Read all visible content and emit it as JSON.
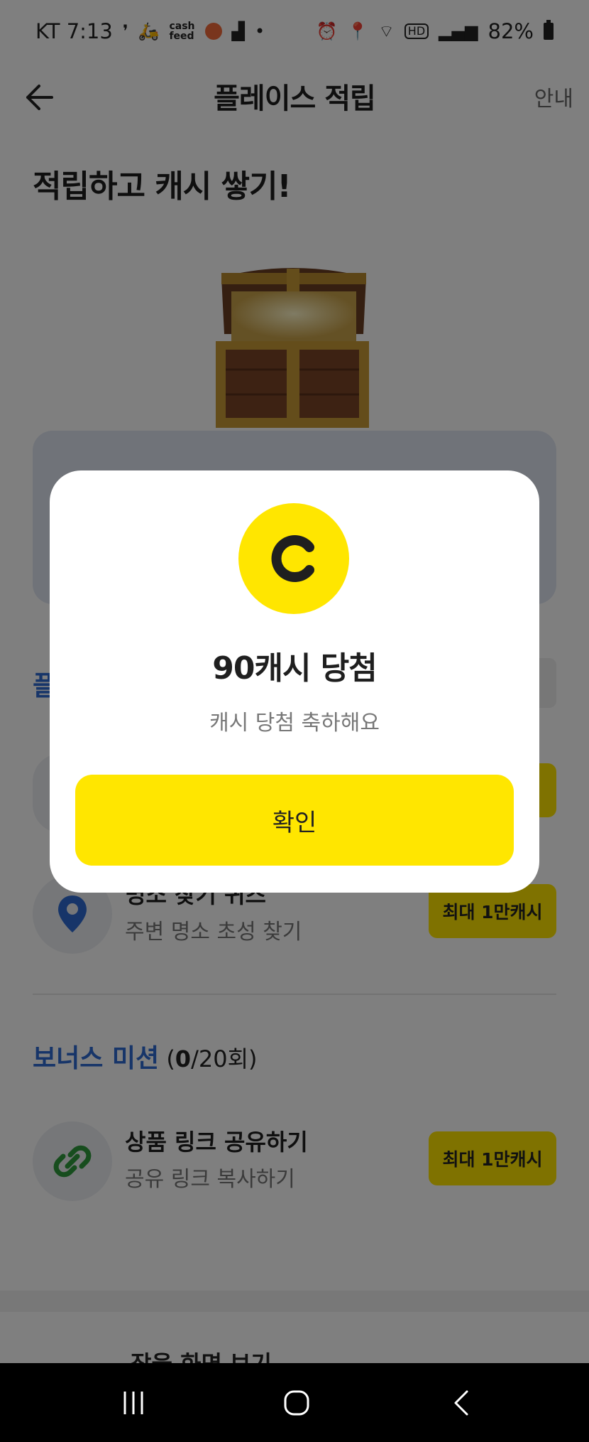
{
  "status_bar": {
    "carrier_time": "KT 7:13",
    "battery": "82%",
    "left_icons": [
      "message-icon",
      "delivery-icon",
      "cashfeed-icon",
      "badge-icon",
      "grid-icon",
      "dot-icon"
    ],
    "right_icons": [
      "alarm-icon",
      "location-icon",
      "wifi-icon",
      "hd-icon",
      "signal-icon",
      "battery-icon"
    ]
  },
  "header": {
    "title": "플레이스 적립",
    "guide_label": "안내"
  },
  "hero": {
    "title": "적립하고 캐시 쌓기!"
  },
  "section": {
    "partial_label": "플"
  },
  "missions": [
    {
      "icon": "location-pin-icon",
      "title": "명소 찾기 퀴즈",
      "subtitle": "주변 명소 초성 찾기",
      "reward": "최대 1만캐시"
    }
  ],
  "bonus": {
    "label": "보너스 미션",
    "count_open": " (",
    "count_current": "0",
    "count_rest": "/20회)",
    "items": [
      {
        "icon": "link-icon",
        "title": "상품 링크 공유하기",
        "subtitle": "공유 링크 복사하기",
        "reward": "최대 1만캐시"
      }
    ]
  },
  "bottom_peek": {
    "title": "잠을 화면 보기"
  },
  "modal": {
    "coin_symbol": "C",
    "title": "90캐시 당첨",
    "subtitle": "캐시 당첨 축하해요",
    "confirm_label": "확인"
  },
  "colors": {
    "accent_yellow": "#ffe600",
    "accent_blue": "#2f6bd3",
    "overlay": "rgba(0,0,0,0.5)"
  }
}
